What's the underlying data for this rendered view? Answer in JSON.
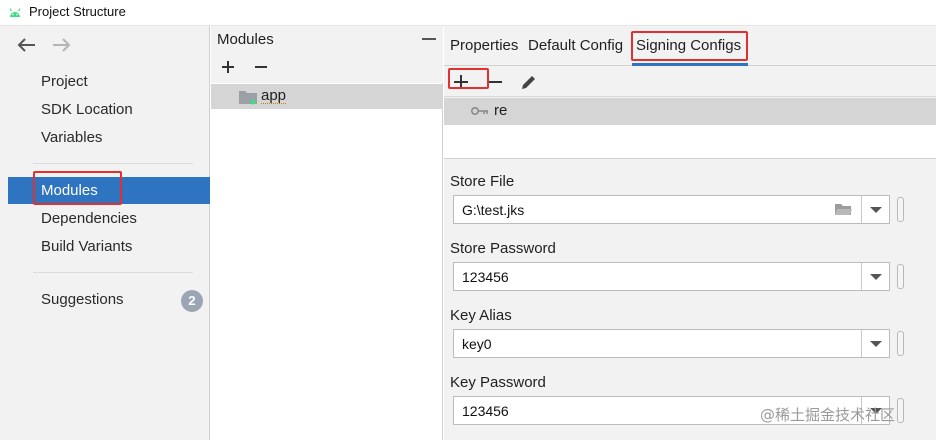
{
  "window": {
    "title": "Project Structure",
    "app_icon": "android-icon"
  },
  "left_panel": {
    "items": [
      {
        "label": "Project"
      },
      {
        "label": "SDK Location"
      },
      {
        "label": "Variables"
      },
      {
        "label": "Modules",
        "selected": true
      },
      {
        "label": "Dependencies"
      },
      {
        "label": "Build Variants"
      },
      {
        "label": "Suggestions",
        "badge": "2"
      }
    ]
  },
  "modules_panel": {
    "title": "Modules",
    "modules": [
      {
        "name": "app"
      }
    ]
  },
  "right_panel": {
    "tabs": [
      {
        "label": "Properties"
      },
      {
        "label": "Default Config"
      },
      {
        "label": "Signing Configs",
        "active": true
      }
    ],
    "signing_configs": [
      {
        "name": "re"
      }
    ],
    "fields": [
      {
        "label": "Store File",
        "value": "G:\\test.jks"
      },
      {
        "label": "Store Password",
        "value": "123456"
      },
      {
        "label": "Key Alias",
        "value": "key0"
      },
      {
        "label": "Key Password",
        "value": "123456"
      }
    ]
  },
  "watermark": "@稀土掘金技术社区",
  "colors": {
    "accent": "#2f74c0",
    "highlight_box": "#e03030",
    "selection": "#d5d5d5"
  }
}
